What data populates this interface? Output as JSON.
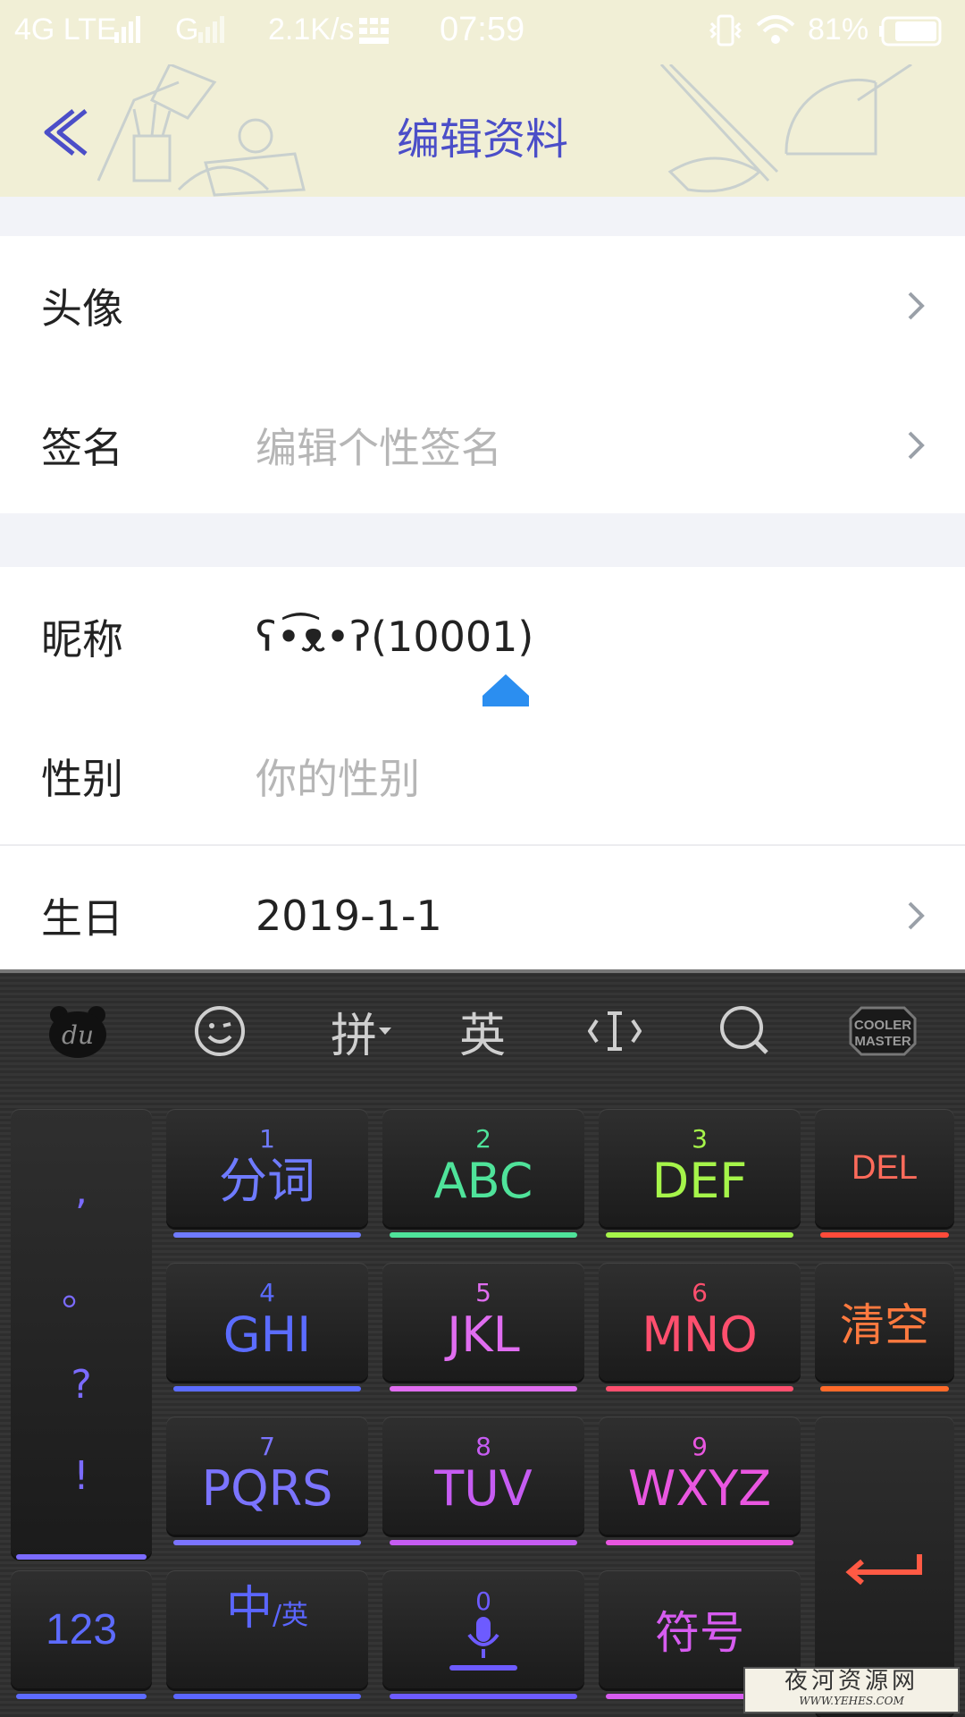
{
  "status_bar": {
    "network": "4G LTE",
    "network2": "G",
    "speed": "2.1K/s",
    "time": "07:59",
    "battery": "81%"
  },
  "header": {
    "title": "编辑资料"
  },
  "profile": {
    "avatar_label": "头像",
    "signature_label": "签名",
    "signature_placeholder": "编辑个性签名",
    "nickname_label": "昵称",
    "nickname_value": "ʕ•͡ᴥ•ʔ(10001)",
    "gender_label": "性别",
    "gender_placeholder": "你的性别",
    "birthday_label": "生日",
    "birthday_value": "2019-1-1"
  },
  "keyboard": {
    "toolbar": {
      "logo": "du",
      "pinyin": "拼",
      "english": "英",
      "brand": "COOLER MASTER"
    },
    "punctuation": [
      ",",
      "。",
      "?",
      "!"
    ],
    "keys": [
      {
        "num": "1",
        "label": "分词",
        "color": "#6f7bff"
      },
      {
        "num": "2",
        "label": "ABC",
        "color": "#4fe39a"
      },
      {
        "num": "3",
        "label": "DEF",
        "color": "#a6f54a"
      },
      {
        "num": "4",
        "label": "GHI",
        "color": "#5b6cff"
      },
      {
        "num": "5",
        "label": "JKL",
        "color": "#e06df0"
      },
      {
        "num": "6",
        "label": "MNO",
        "color": "#ff4f6e"
      },
      {
        "num": "7",
        "label": "PQRS",
        "color": "#7b74ff"
      },
      {
        "num": "8",
        "label": "TUV",
        "color": "#c65cf2"
      },
      {
        "num": "9",
        "label": "WXYZ",
        "color": "#e956e0"
      }
    ],
    "del_label": "DEL",
    "clear_label": "清空",
    "num_label": "123",
    "lang_main": "中",
    "lang_sub": "/英",
    "space_num": "0",
    "symbol_label": "符号",
    "colors": {
      "del": "#ff6b5b",
      "clear": "#ff7a3f",
      "enter": "#ff5a44",
      "num": "#5d6bff",
      "lang": "#5b66ff",
      "mic": "#6d5bff",
      "symbol": "#d75cf0",
      "punct": "#7b6bff"
    }
  },
  "watermark": {
    "line1": "夜河资源网",
    "line2": "WWW.YEHES.COM"
  }
}
